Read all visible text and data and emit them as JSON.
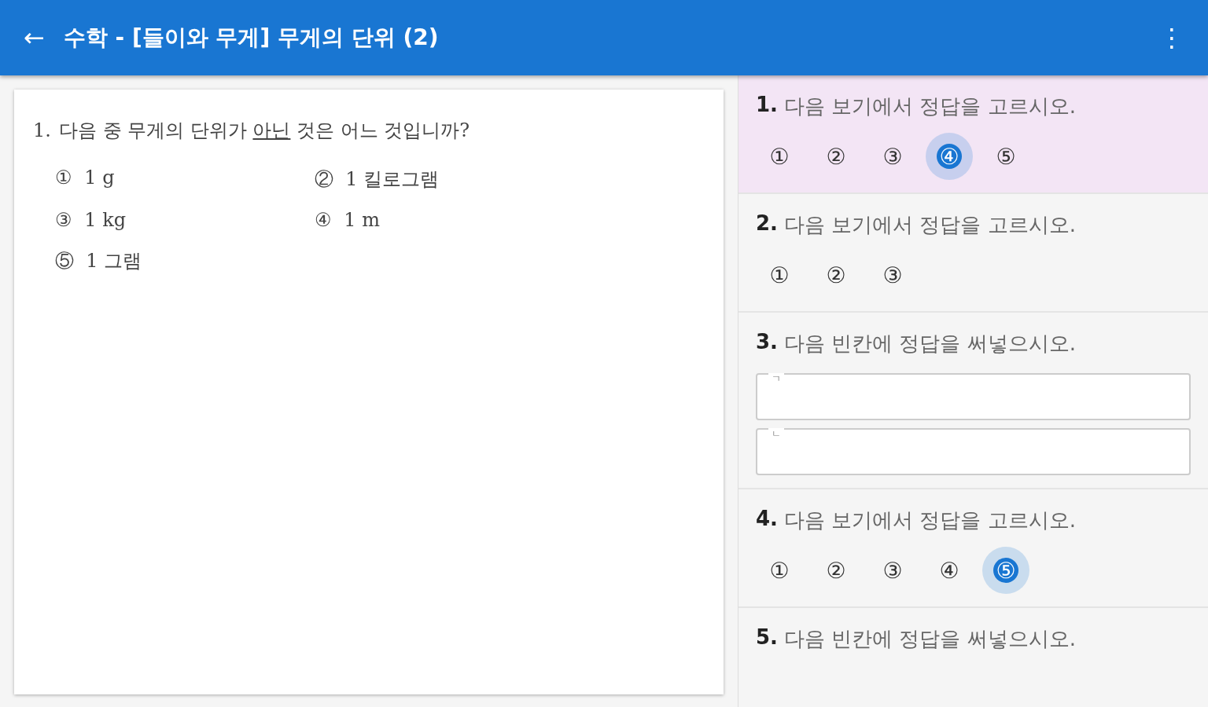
{
  "app_bar": {
    "back_icon": "←",
    "title": "수학 - [들이와 무게] 무게의 단위 (2)",
    "menu_icon": "⋮"
  },
  "question": {
    "number": "1.",
    "parts": [
      {
        "text": "다음 중 무게의 단위가 ",
        "underline": false
      },
      {
        "text": "아닌",
        "underline": true
      },
      {
        "text": " 것은 어느 것입니까?",
        "underline": false
      }
    ],
    "options": [
      {
        "mark": "①",
        "text": "1 g"
      },
      {
        "mark": "②",
        "text": "1 킬로그램"
      },
      {
        "mark": "③",
        "text": "1 kg"
      },
      {
        "mark": "④",
        "text": "1 m"
      },
      {
        "mark": "⑤",
        "text": "1 그램"
      }
    ]
  },
  "answers": [
    {
      "kind": "choice",
      "number": "1.",
      "prompt": "다음 보기에서 정답을 고르시오.",
      "selected": true,
      "choices": [
        {
          "label": "①",
          "selected": false
        },
        {
          "label": "②",
          "selected": false
        },
        {
          "label": "③",
          "selected": false
        },
        {
          "label": "④",
          "selected": true
        },
        {
          "label": "⑤",
          "selected": false
        }
      ]
    },
    {
      "kind": "choice",
      "number": "2.",
      "prompt": "다음 보기에서 정답을 고르시오.",
      "selected": false,
      "choices": [
        {
          "label": "①",
          "selected": false
        },
        {
          "label": "②",
          "selected": false
        },
        {
          "label": "③",
          "selected": false
        }
      ]
    },
    {
      "kind": "blank",
      "number": "3.",
      "prompt": "다음 빈칸에 정답을 써넣으시오.",
      "selected": false,
      "fields": [
        {
          "label": "ㄱ"
        },
        {
          "label": "ㄴ"
        }
      ]
    },
    {
      "kind": "choice",
      "number": "4.",
      "prompt": "다음 보기에서 정답을 고르시오.",
      "selected": false,
      "choices": [
        {
          "label": "①",
          "selected": false
        },
        {
          "label": "②",
          "selected": false
        },
        {
          "label": "③",
          "selected": false
        },
        {
          "label": "④",
          "selected": false
        },
        {
          "label": "⑤",
          "selected": true
        }
      ]
    },
    {
      "kind": "heading",
      "number": "5.",
      "prompt": "다음 빈칸에 정답을 써넣으시오.",
      "selected": false
    }
  ]
}
